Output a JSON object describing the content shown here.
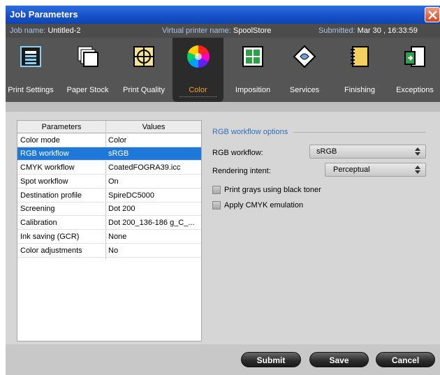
{
  "window": {
    "title": "Job Parameters",
    "close_icon": "close-icon"
  },
  "info": {
    "job_label": "Job name:",
    "job_value": "Untitled-2",
    "printer_label": "Virtual printer name:",
    "printer_value": "SpoolStore",
    "submitted_label": "Submitted:",
    "submitted_value": "Mar 30 , 16:33:59"
  },
  "toolbar": {
    "items": [
      {
        "label": "Print Settings",
        "icon": "print-settings-icon"
      },
      {
        "label": "Paper Stock",
        "icon": "paper-stock-icon"
      },
      {
        "label": "Print Quality",
        "icon": "print-quality-icon"
      },
      {
        "label": "Color",
        "icon": "color-wheel-icon",
        "active": true
      },
      {
        "label": "Imposition",
        "icon": "imposition-icon"
      },
      {
        "label": "Services",
        "icon": "services-icon"
      },
      {
        "label": "Finishing",
        "icon": "finishing-icon"
      },
      {
        "label": "Exceptions",
        "icon": "exceptions-icon"
      }
    ]
  },
  "params": {
    "col_param": "Parameters",
    "col_value": "Values",
    "rows": [
      {
        "name": "Color mode",
        "value": "Color"
      },
      {
        "name": "RGB workflow",
        "value": "sRGB",
        "selected": true
      },
      {
        "name": "CMYK workflow",
        "value": "CoatedFOGRA39.icc"
      },
      {
        "name": "Spot workflow",
        "value": "On"
      },
      {
        "name": "Destination profile",
        "value": "SpireDC5000"
      },
      {
        "name": "Screening",
        "value": "Dot 200"
      },
      {
        "name": "Calibration",
        "value": "Dot 200_136-186 g_C_..."
      },
      {
        "name": "Ink saving (GCR)",
        "value": "None"
      },
      {
        "name": "Color adjustments",
        "value": "No"
      }
    ]
  },
  "options": {
    "title": "RGB workflow options",
    "rgb_label": "RGB workflow:",
    "rgb_value": "sRGB",
    "intent_label": "Rendering intent:",
    "intent_value": "Perceptual",
    "chk_grays": "Print grays using black toner",
    "chk_cmyk": "Apply CMYK emulation"
  },
  "buttons": {
    "submit": "Submit",
    "save": "Save",
    "cancel": "Cancel"
  },
  "colors": {
    "accent": "#f0a030",
    "selection": "#1e78d8",
    "titlebar": "#1751c8"
  }
}
